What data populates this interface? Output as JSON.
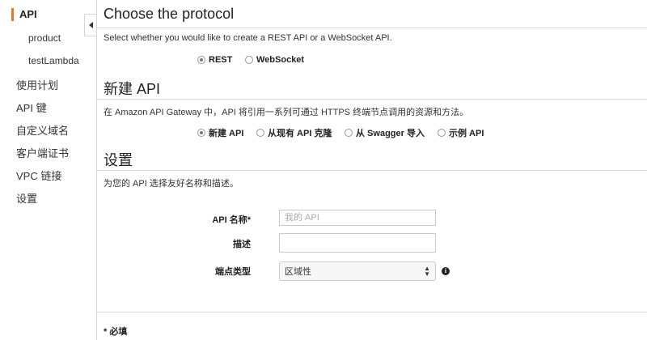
{
  "sidebar": {
    "items": [
      {
        "label": "API"
      },
      {
        "label": "product"
      },
      {
        "label": "testLambda"
      },
      {
        "label": "使用计划"
      },
      {
        "label": "API 键"
      },
      {
        "label": "自定义域名"
      },
      {
        "label": "客户端证书"
      },
      {
        "label": "VPC 链接"
      },
      {
        "label": "设置"
      }
    ]
  },
  "protocol": {
    "title": "Choose the protocol",
    "description": "Select whether you would like to create a REST API or a WebSocket API.",
    "options": [
      {
        "label": "REST",
        "checked": true
      },
      {
        "label": "WebSocket",
        "checked": false
      }
    ]
  },
  "new_api": {
    "title": "新建 API",
    "description": "在 Amazon API Gateway 中，API 将引用一系列可通过 HTTPS 终端节点调用的资源和方法。",
    "options": [
      {
        "label": "新建 API",
        "checked": true
      },
      {
        "label": "从现有 API 克隆",
        "checked": false
      },
      {
        "label": "从 Swagger 导入",
        "checked": false
      },
      {
        "label": "示例 API",
        "checked": false
      }
    ]
  },
  "settings": {
    "title": "设置",
    "description": "为您的 API 选择友好名称和描述。",
    "api_name_label": "API 名称*",
    "api_name_placeholder": "我的 API",
    "description_label": "描述",
    "endpoint_type_label": "端点类型",
    "endpoint_type_value": "区域性"
  },
  "footer": {
    "required_note": "* 必填"
  }
}
